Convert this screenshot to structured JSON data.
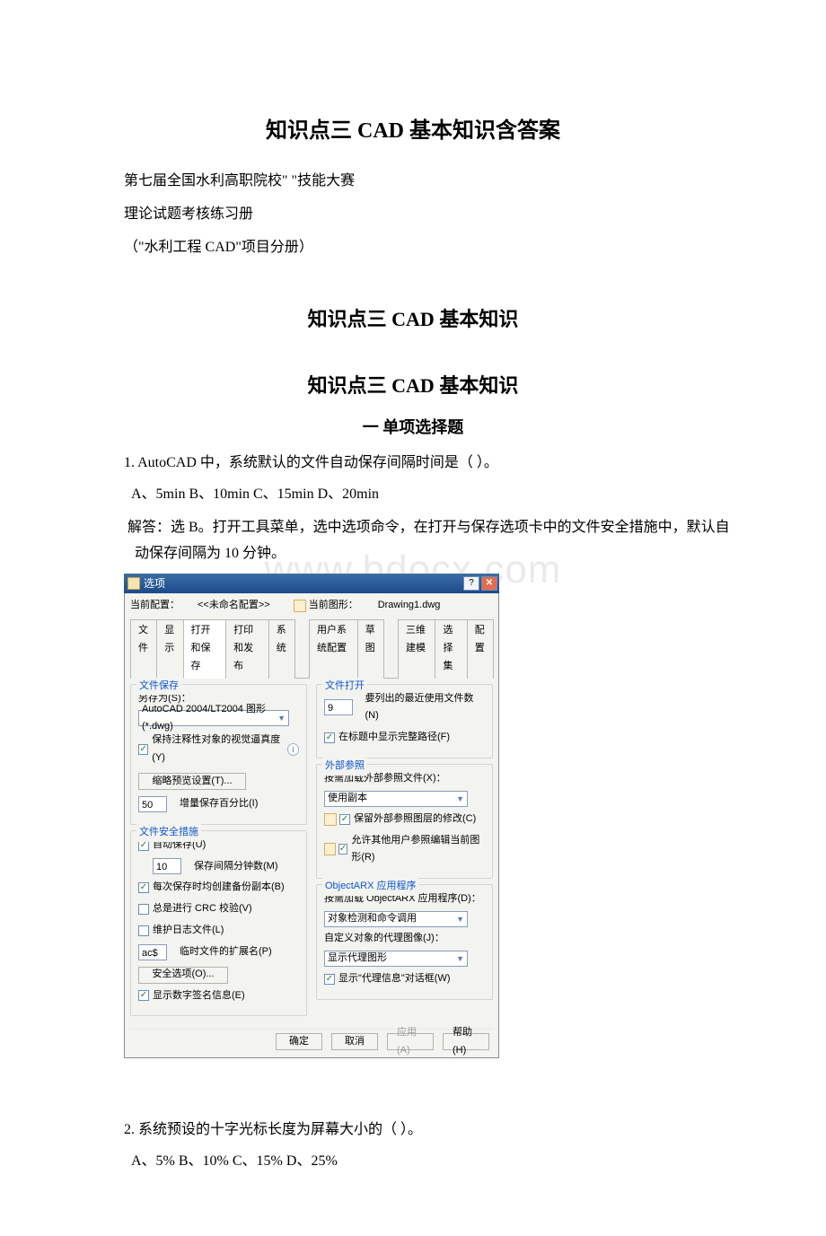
{
  "title_main": "知识点三 CAD 基本知识含答案",
  "intro": {
    "line1": "第七届全国水利高职院校\" \"技能大赛",
    "line2": "理论试题考核练习册",
    "line3": "（\"水利工程 CAD\"项目分册）"
  },
  "sub_title_1": "知识点三 CAD 基本知识",
  "sub_title_2": "知识点三 CAD 基本知识",
  "section_header": "一 单项选择题",
  "q1": {
    "text": "1. AutoCAD 中，系统默认的文件自动保存间隔时间是（ ）。",
    "options": " A、5min B、10min C、15min D、20min",
    "answer": " 解答：选 B。打开工具菜单，选中选项命令，在打开与保存选项卡中的文件安全措施中，默认自动保存间隔为 10 分钟。"
  },
  "q2": {
    "text": "2. 系统预设的十字光标长度为屏幕大小的（ ）。",
    "options": " A、5% B、10% C、15% D、25%"
  },
  "watermark": "www.bdocx.com",
  "dialog": {
    "title_icon": "⬚",
    "title": "选项",
    "help_btn": "?",
    "close_btn": "✕",
    "cur_config_label": "当前配置：",
    "cur_config_value": "<<未命名配置>>",
    "cur_drawing_label": "当前图形：",
    "cur_drawing_value": "Drawing1.dwg",
    "tabs": [
      "文件",
      "显示",
      "打开和保存",
      "打印和发布",
      "系统",
      "用户系统配置",
      "草图",
      "三维建模",
      "选择集",
      "配置"
    ],
    "active_tab_index": 2,
    "left": {
      "file_save": {
        "title": "文件保存",
        "saveas_label": "另存为(S)：",
        "saveas_value": "AutoCAD 2004/LT2004 图形 (*.dwg)",
        "annot_cb": "保持注释性对象的视觉逼真度(Y)",
        "thumb_btn": "缩略预览设置(T)...",
        "incr_value": "50",
        "incr_label": "增量保存百分比(I)"
      },
      "file_safety": {
        "title": "文件安全措施",
        "autosave_cb": "自动保存(U)",
        "interval_value": "10",
        "interval_label": "保存间隔分钟数(M)",
        "backup_cb": "每次保存时均创建备份副本(B)",
        "crc_cb": "总是进行 CRC 校验(V)",
        "log_cb": "维护日志文件(L)",
        "ext_value": "ac$",
        "ext_label": "临时文件的扩展名(P)",
        "sec_btn": "安全选项(O)...",
        "sig_cb": "显示数字签名信息(E)"
      }
    },
    "right": {
      "file_open": {
        "title": "文件打开",
        "recent_value": "9",
        "recent_label": "要列出的最近使用文件数(N)",
        "fullpath_cb": "在标题中显示完整路径(F)"
      },
      "xref": {
        "title": "外部参照",
        "load_label": "按需加载外部参照文件(X)：",
        "load_value": "使用副本",
        "keep_cb": "保留外部参照图层的修改(C)",
        "allow_cb": "允许其他用户参照编辑当前图形(R)"
      },
      "arx": {
        "title": "ObjectARX 应用程序",
        "load_label": "按需加载 ObjectARX 应用程序(D)：",
        "load_value": "对象检测和命令调用",
        "proxy_label": "自定义对象的代理图像(J)：",
        "proxy_value": "显示代理图形",
        "show_cb": "显示\"代理信息\"对话框(W)"
      }
    },
    "footer": {
      "ok": "确定",
      "cancel": "取消",
      "apply": "应用(A)",
      "help": "帮助(H)"
    }
  }
}
